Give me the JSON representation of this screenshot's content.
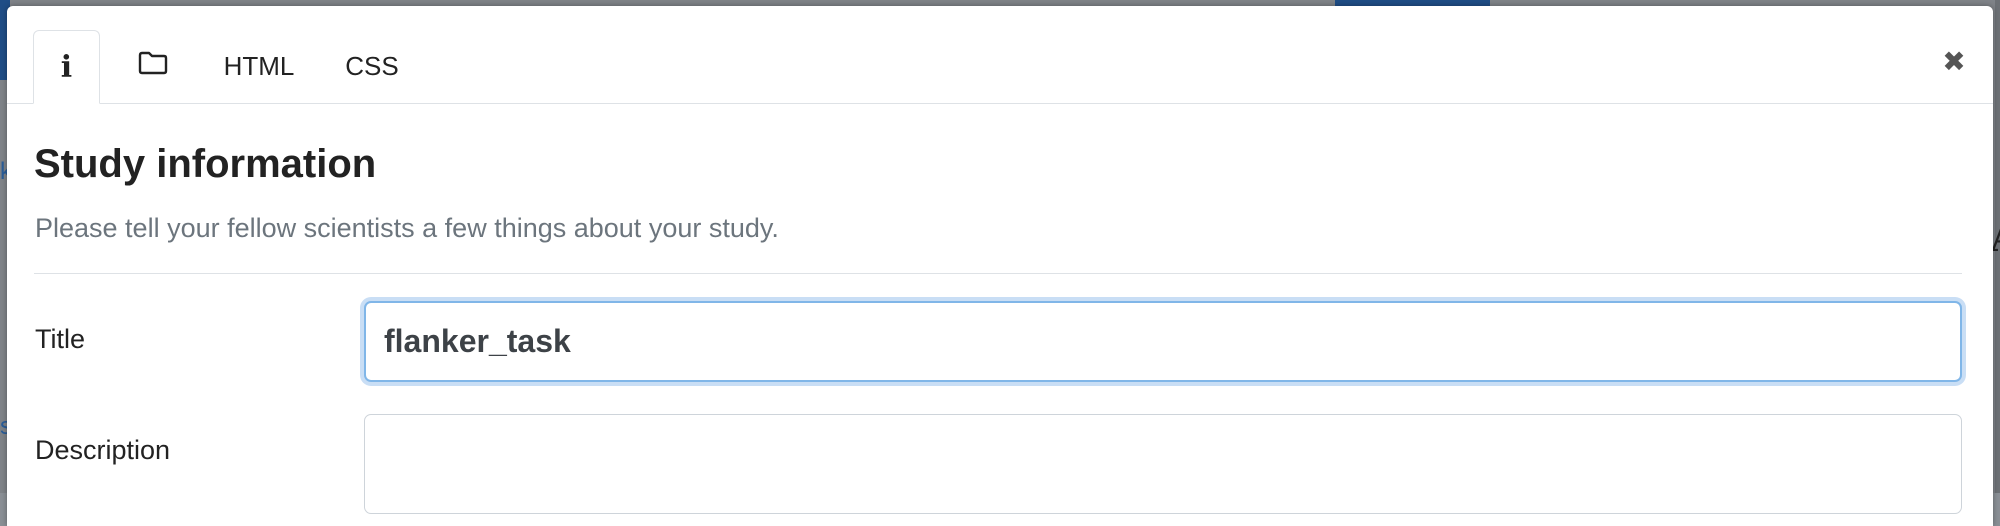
{
  "tabs": [
    {
      "name": "info",
      "icon": "info-icon",
      "glyph": "i",
      "active": true
    },
    {
      "name": "files",
      "icon": "folder-icon",
      "active": false
    },
    {
      "name": "html",
      "label": "HTML",
      "active": false
    },
    {
      "name": "css",
      "label": "CSS",
      "active": false
    }
  ],
  "close_glyph": "✖",
  "section": {
    "heading": "Study information",
    "subtext": "Please tell your fellow scientists a few things about your study."
  },
  "form": {
    "title_label": "Title",
    "title_value": "flanker_task",
    "description_label": "Description",
    "description_value": ""
  },
  "colors": {
    "accent_focus": "#80b6e8",
    "muted_text": "#6c757d"
  }
}
